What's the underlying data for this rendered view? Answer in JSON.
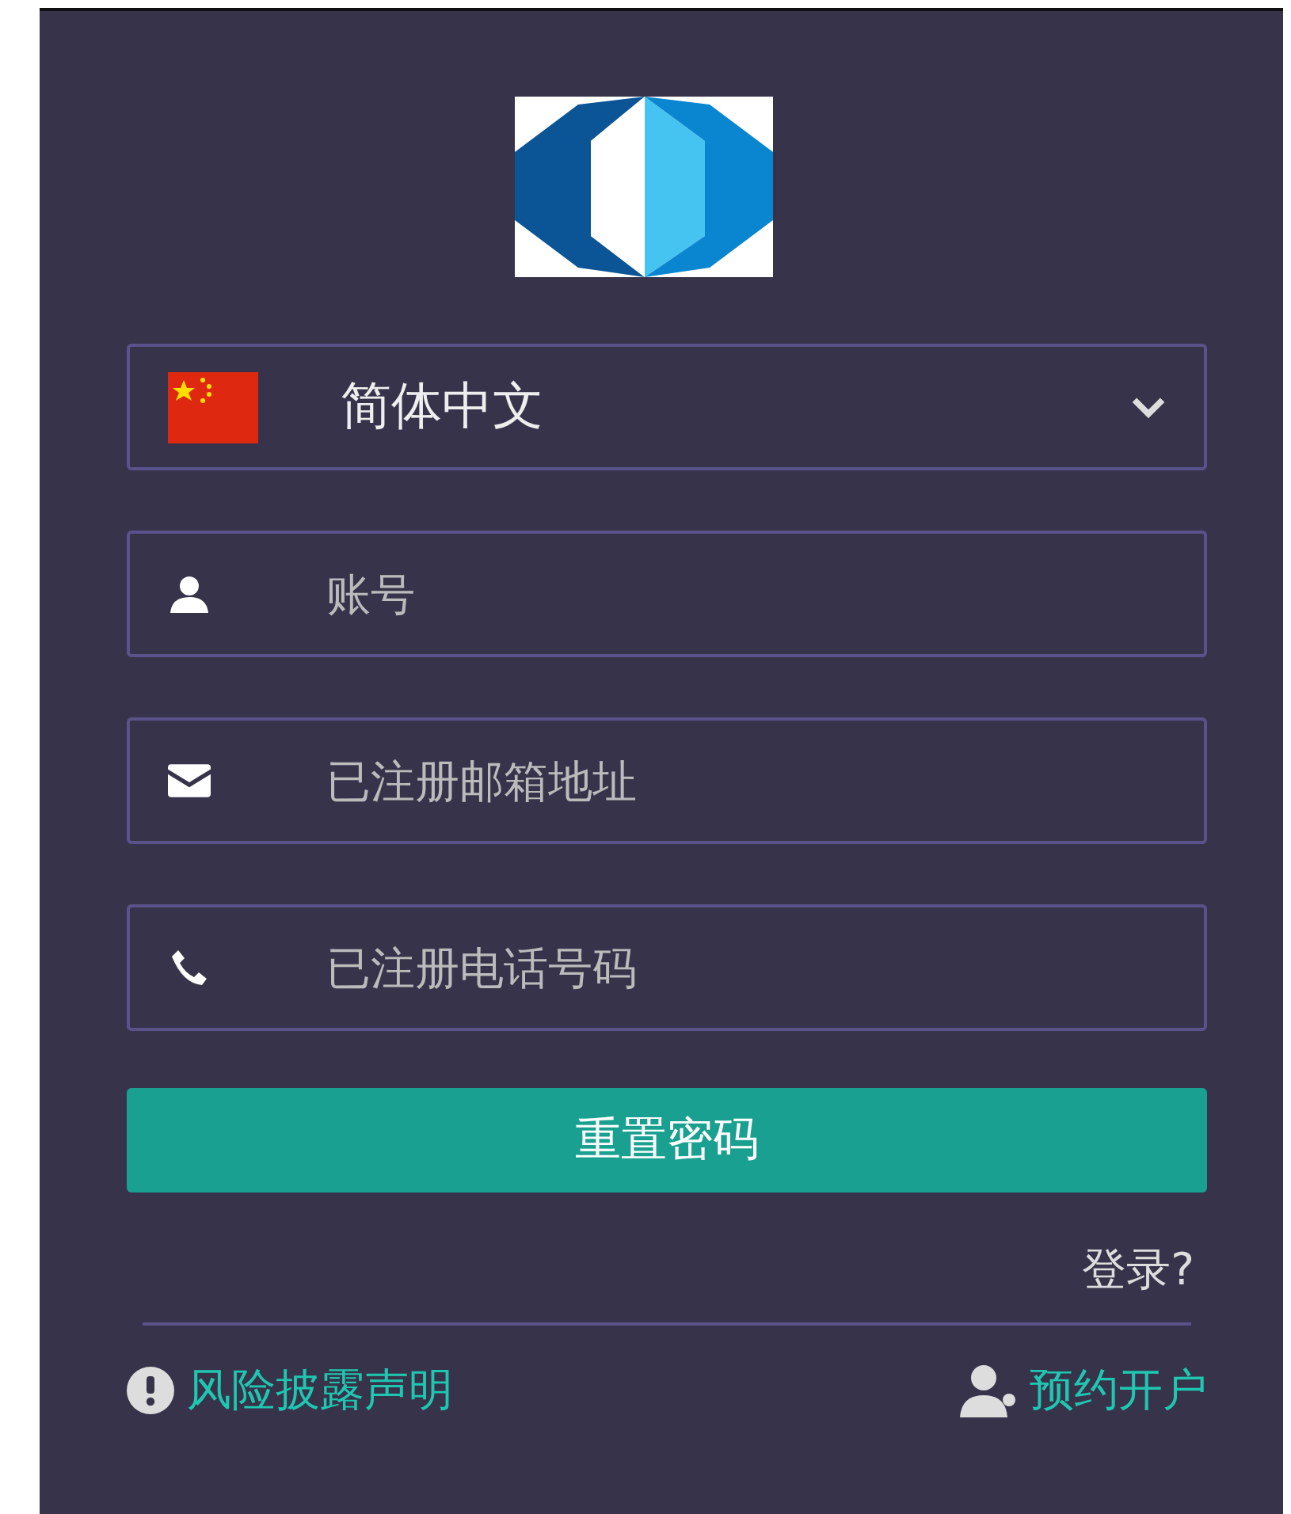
{
  "language_select": {
    "value": "简体中文"
  },
  "fields": [
    {
      "kind": "user",
      "placeholder": "账号"
    },
    {
      "kind": "mail",
      "placeholder": "已注册邮箱地址"
    },
    {
      "kind": "phone",
      "placeholder": "已注册电话号码"
    }
  ],
  "submit_button": "重置密码",
  "login_link": "登录?",
  "footer_links": [
    {
      "kind": "warning",
      "label": "风险披露声明"
    },
    {
      "kind": "add-user",
      "label": "预约开户"
    }
  ]
}
